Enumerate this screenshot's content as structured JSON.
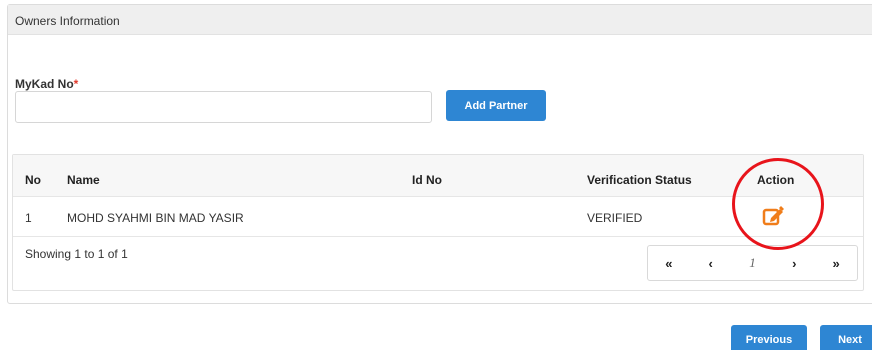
{
  "panel": {
    "title": "Owners Information"
  },
  "form": {
    "mykad_label": "MyKad No",
    "required_mark": "*",
    "mykad_value": "",
    "add_partner_label": "Add Partner"
  },
  "table": {
    "headers": {
      "no": "No",
      "name": "Name",
      "id_no": "Id No",
      "status": "Verification Status",
      "action": "Action"
    },
    "rows": [
      {
        "no": "1",
        "name": "MOHD SYAHMI BIN MAD YASIR",
        "id_no": "",
        "status": "VERIFIED",
        "action_icon": "edit-icon"
      }
    ],
    "showing": "Showing 1 to 1 of 1"
  },
  "pagination": {
    "first": "«",
    "prev": "‹",
    "current": "1",
    "next": "›",
    "last": "»"
  },
  "footer": {
    "previous_label": "Previous",
    "next_label": "Next"
  },
  "colors": {
    "primary": "#2e86d3",
    "edit_icon": "#f07d1a",
    "highlight_circle": "#e8141b",
    "required": "#e23a2d"
  }
}
